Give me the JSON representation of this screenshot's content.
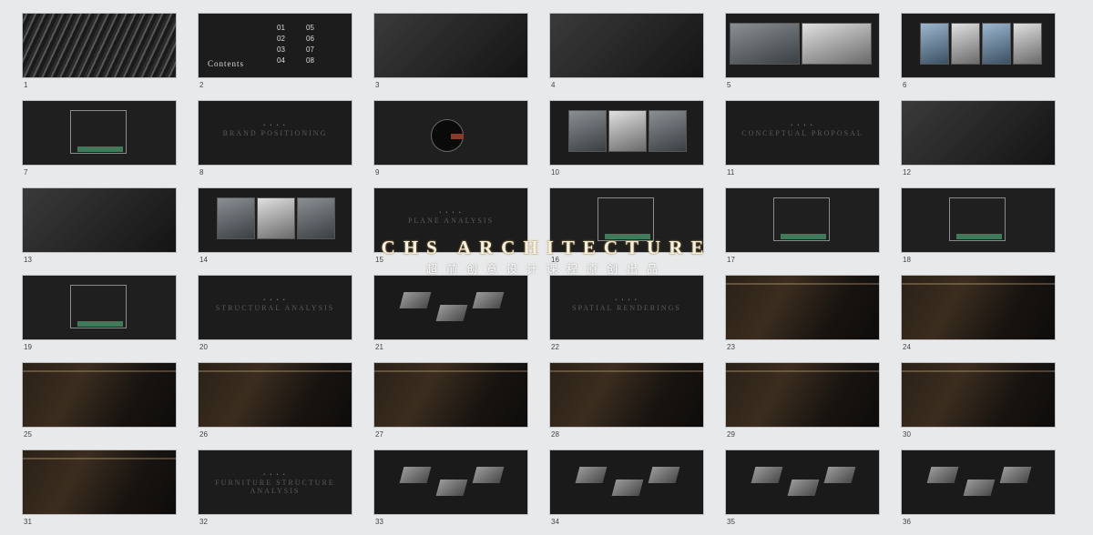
{
  "watermark": {
    "line1": "CHS ARCHITECTURE",
    "line2": "超前创意设计课程原创出品"
  },
  "contents": {
    "title": "Contents",
    "numbers": [
      "01",
      "05",
      "02",
      "06",
      "03",
      "07",
      "04",
      "08"
    ]
  },
  "slides": [
    {
      "n": "1",
      "kind": "cover"
    },
    {
      "n": "2",
      "kind": "contents"
    },
    {
      "n": "3",
      "kind": "photo"
    },
    {
      "n": "4",
      "kind": "photo"
    },
    {
      "n": "5",
      "kind": "photos2",
      "text": ""
    },
    {
      "n": "6",
      "kind": "photos4"
    },
    {
      "n": "7",
      "kind": "plan"
    },
    {
      "n": "8",
      "kind": "title",
      "label": "BRAND POSITIONING"
    },
    {
      "n": "9",
      "kind": "circle"
    },
    {
      "n": "10",
      "kind": "photos3"
    },
    {
      "n": "11",
      "kind": "title",
      "label": "CONCEPTUAL PROPOSAL"
    },
    {
      "n": "12",
      "kind": "photo"
    },
    {
      "n": "13",
      "kind": "photo"
    },
    {
      "n": "14",
      "kind": "photos3"
    },
    {
      "n": "15",
      "kind": "title",
      "label": "PLANE ANALYSIS"
    },
    {
      "n": "16",
      "kind": "plan"
    },
    {
      "n": "17",
      "kind": "plan"
    },
    {
      "n": "18",
      "kind": "plan"
    },
    {
      "n": "19",
      "kind": "plan"
    },
    {
      "n": "20",
      "kind": "title",
      "label": "STRUCTURAL ANALYSIS"
    },
    {
      "n": "21",
      "kind": "model"
    },
    {
      "n": "22",
      "kind": "title",
      "label": "SPATIAL RENDERINGS"
    },
    {
      "n": "23",
      "kind": "render"
    },
    {
      "n": "24",
      "kind": "render"
    },
    {
      "n": "25",
      "kind": "render"
    },
    {
      "n": "26",
      "kind": "render"
    },
    {
      "n": "27",
      "kind": "render"
    },
    {
      "n": "28",
      "kind": "render"
    },
    {
      "n": "29",
      "kind": "render"
    },
    {
      "n": "30",
      "kind": "render"
    },
    {
      "n": "31",
      "kind": "render"
    },
    {
      "n": "32",
      "kind": "title",
      "label": "FURNITURE STRUCTURE ANALYSIS"
    },
    {
      "n": "33",
      "kind": "model"
    },
    {
      "n": "34",
      "kind": "model"
    },
    {
      "n": "35",
      "kind": "model"
    },
    {
      "n": "36",
      "kind": "model"
    }
  ]
}
